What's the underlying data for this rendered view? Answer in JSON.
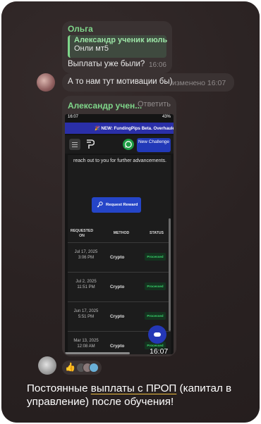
{
  "message1": {
    "sender": "Ольга",
    "reply_name": "Александр ученик июль",
    "reply_text": "Онли мт5",
    "text": "Выплаты уже были?",
    "time": "16:06"
  },
  "message2": {
    "text": "А то нам тут мотивации бы)",
    "status": "изменено 16:07"
  },
  "message3": {
    "sender": "Александр учен...",
    "reply_action": "Ответить",
    "time": "16:07",
    "screenshot": {
      "status_time": "16:07",
      "status_right": "43%",
      "banner": "🎉 NEW: FundingPips Beta. Overhauled",
      "new_challenge": "New Challenge",
      "paragraph": "reach out to you for further advancements.",
      "request_reward": "Request Reward",
      "headers": {
        "requested": "REQUESTED ON",
        "method": "METHOD",
        "status": "STATUS"
      },
      "rows": [
        {
          "date": "Jul 17, 2025 3:06 PM",
          "method": "Crypto",
          "status": "Processed"
        },
        {
          "date": "Jul 2, 2025 11:51 PM",
          "method": "Crypto",
          "status": "Processed"
        },
        {
          "date": "Jun 17, 2025 5:51 PM",
          "method": "Crypto",
          "status": "Processed"
        },
        {
          "date": "Mar 13, 2025 12:08 AM",
          "method": "Crypto",
          "status": "Processed"
        }
      ]
    }
  },
  "reactions": {
    "emoji": "👍"
  },
  "caption": {
    "part1": "Постоянные ",
    "part2": "выплаты с ПРОП",
    "part3": " (капитал в управление) после обучения!"
  },
  "colors": {
    "accent_green": "#7fd68a",
    "bubble": "#3a3232",
    "brand_blue": "#2437b6"
  }
}
